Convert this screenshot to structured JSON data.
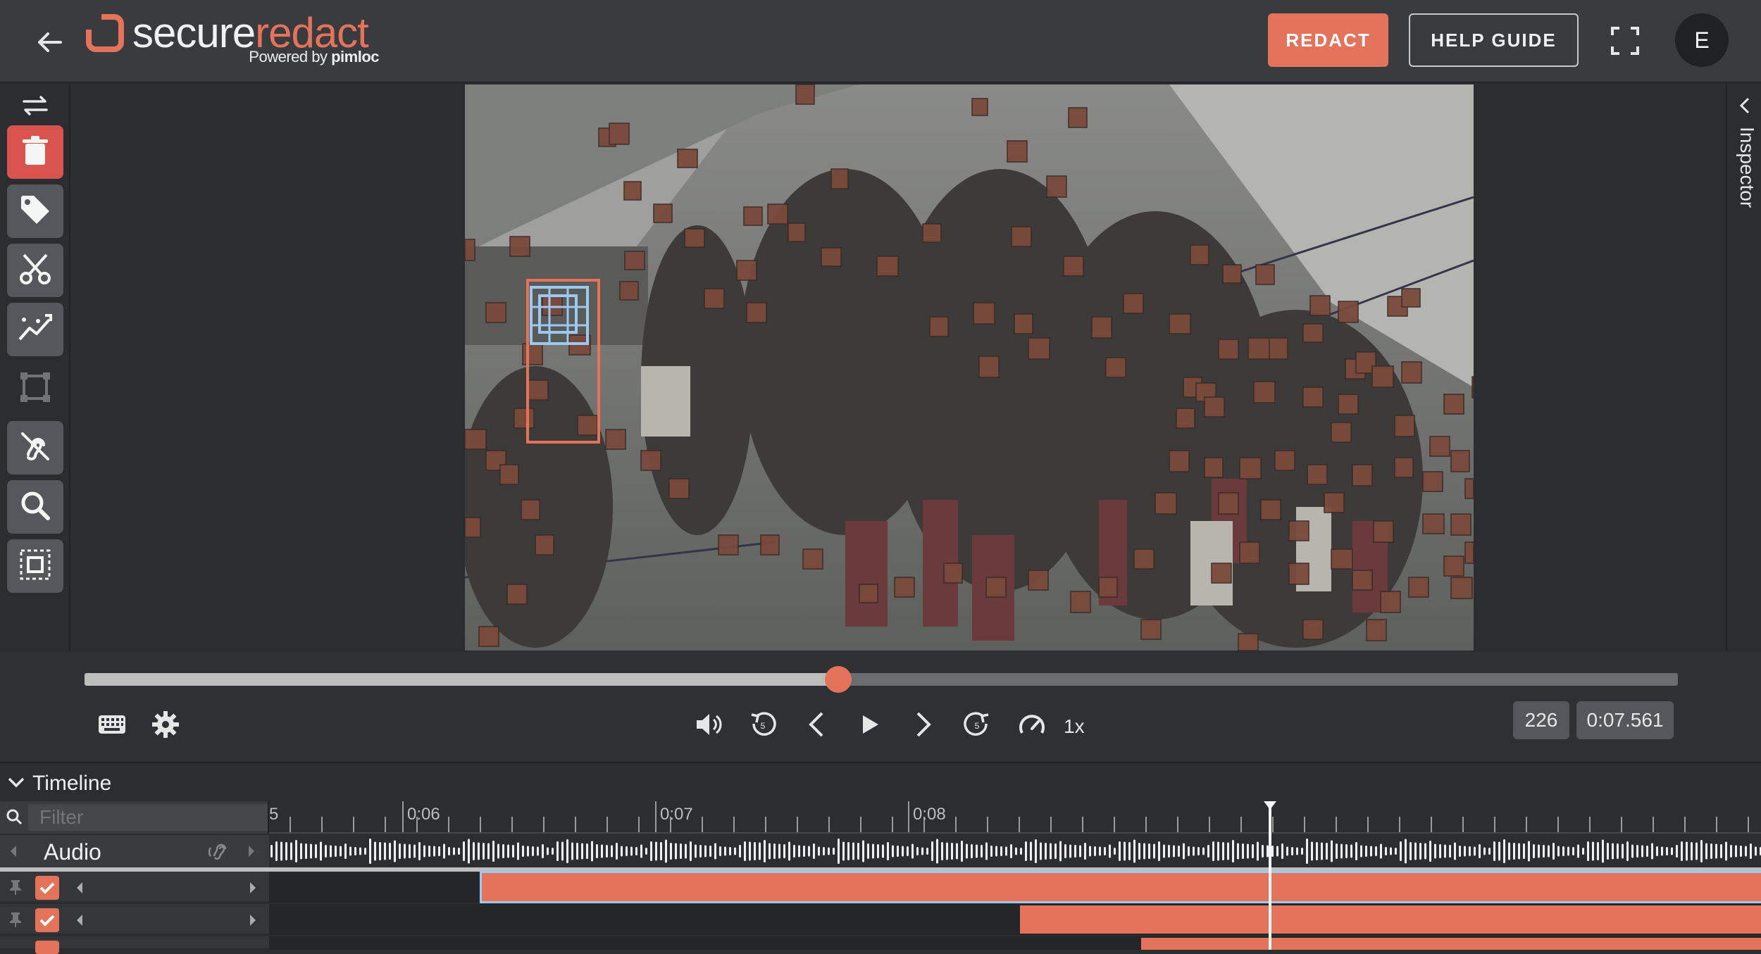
{
  "header": {
    "logo_secure": "secure",
    "logo_redact": "redact",
    "logo_powered": "Powered by",
    "logo_pimloc": "pimloc",
    "redact_label": "REDACT",
    "help_label": "HELP GUIDE",
    "avatar_initial": "E"
  },
  "sidebar": {
    "tools": [
      {
        "icon": "trash-icon",
        "active": true
      },
      {
        "icon": "tag-icon",
        "active": false
      },
      {
        "icon": "scissors-icon",
        "active": false
      },
      {
        "icon": "tracking-icon",
        "active": false
      },
      {
        "icon": "bounding-box-icon",
        "active": false,
        "disabled": true
      },
      {
        "icon": "audio-mute-icon",
        "active": false
      },
      {
        "icon": "search-icon",
        "active": false
      },
      {
        "icon": "select-region-icon",
        "active": false
      }
    ]
  },
  "inspector": {
    "label": "Inspector"
  },
  "player": {
    "progress": 0.473,
    "rate": "1x",
    "frame": "226",
    "time": "0:07.561"
  },
  "timeline": {
    "title": "Timeline",
    "filter_placeholder": "Filter",
    "audio_label": "Audio",
    "ticks": [
      "5",
      "0:06",
      "0:07",
      "0:08"
    ]
  },
  "colors": {
    "accent": "#e3735a",
    "background": "#2b2d31",
    "selection": "#9cc9f0"
  }
}
